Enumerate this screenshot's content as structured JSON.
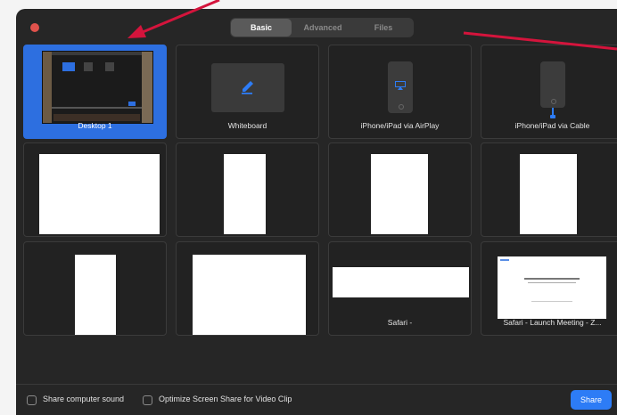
{
  "tabs": [
    {
      "label": "Basic",
      "active": true
    },
    {
      "label": "Advanced",
      "active": false
    },
    {
      "label": "Files",
      "active": false
    }
  ],
  "tiles": {
    "desktop": {
      "label": "Desktop 1"
    },
    "whiteboard": {
      "label": "Whiteboard"
    },
    "airplay": {
      "label": "iPhone/iPad via AirPlay"
    },
    "cable": {
      "label": "iPhone/iPad via Cable"
    },
    "safari_1": {
      "label": "Safari -"
    },
    "safari_2": {
      "label": "Safari - Launch Meeting - Z..."
    }
  },
  "footer": {
    "share_sound_label": "Share computer sound",
    "optimize_label": "Optimize Screen Share for Video Clip",
    "share_button": "Share"
  },
  "colors": {
    "selected": "#2d6fe0",
    "share_button": "#2d7cf6",
    "annotation_arrow": "#d4143c"
  }
}
